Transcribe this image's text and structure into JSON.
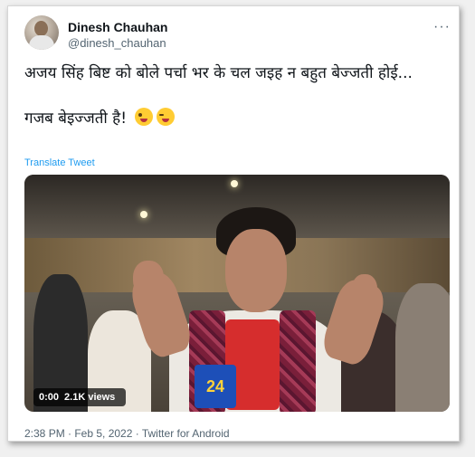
{
  "author": {
    "name": "Dinesh Chauhan",
    "handle": "@dinesh_chauhan"
  },
  "menu_label": "···",
  "tweet": {
    "line1": "अजय सिंह बिष्ट को बोले पर्चा भर के चल जइह न बहुत बेज्जती होई...",
    "line2": "गजब बेइज्जती है!",
    "emojis": [
      "winking-face-with-tongue-icon",
      "face-with-tears-of-joy-icon"
    ],
    "translate_label": "Translate Tweet"
  },
  "video": {
    "time": "0:00",
    "views": "2.1K views",
    "channel_logo": "24"
  },
  "footer": {
    "timestamp": "2:38 PM · Feb 5, 2022 · Twitter for Android"
  },
  "colors": {
    "link": "#1d9bf0",
    "secondary_text": "#536471",
    "primary_text": "#0f1419"
  }
}
